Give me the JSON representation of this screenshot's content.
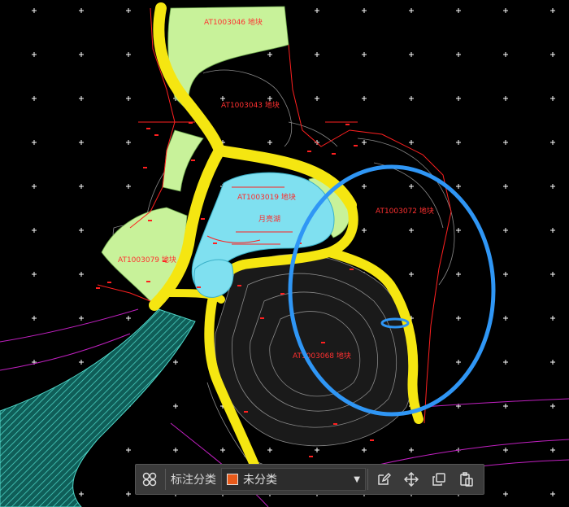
{
  "drawing": {
    "labels": {
      "parcel_top": "AT1003046 地块",
      "parcel_upper": "AT1003043 地块",
      "parcel_lake": "AT1003019 地块",
      "lake_name": "月亮湖",
      "parcel_right": "AT1003072 地块",
      "parcel_left": "AT1003079 地块",
      "parcel_lower": "AT1003068 地块"
    },
    "colors": {
      "background": "#000000",
      "road": "#f5e611",
      "green_land": "#c8f29a",
      "lake": "#7fe0f0",
      "river": "#1d8f86",
      "red_lines": "#ff2020",
      "annotation_circle": "#2f96f5"
    }
  },
  "toolbar": {
    "layer_icon": "four-circles-icon",
    "label": "标注分类",
    "category": {
      "selected": "未分类",
      "swatch_color": "#e85a1a"
    },
    "buttons": [
      "edit-icon",
      "move-icon",
      "copy-icon",
      "paste-icon"
    ]
  }
}
